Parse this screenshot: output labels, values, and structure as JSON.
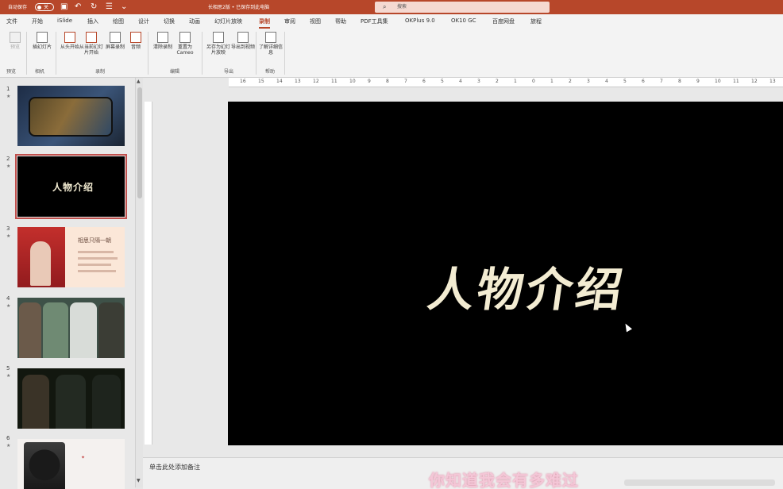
{
  "title_bar": {
    "autosave_label": "自动保存",
    "autosave_state": "关",
    "doc_title": "长相思2版 • 已保存到此电脑",
    "search_placeholder": "搜索"
  },
  "menu": {
    "tabs": [
      {
        "label": "文件"
      },
      {
        "label": "开始"
      },
      {
        "label": "iSlide"
      },
      {
        "label": "插入"
      },
      {
        "label": "绘图"
      },
      {
        "label": "设计"
      },
      {
        "label": "切换"
      },
      {
        "label": "动画"
      },
      {
        "label": "幻灯片放映"
      },
      {
        "label": "录制"
      },
      {
        "label": "审阅"
      },
      {
        "label": "视图"
      },
      {
        "label": "帮助"
      },
      {
        "label": "PDF工具集"
      },
      {
        "label": "OKPlus 9.0"
      },
      {
        "label": "OK10 GC"
      },
      {
        "label": "百度网盘"
      },
      {
        "label": "旅程"
      }
    ],
    "active": "录制"
  },
  "ribbon": {
    "buttons": [
      {
        "label": "预览"
      },
      {
        "label": "插幻灯片"
      },
      {
        "label": "从头开始"
      },
      {
        "label": "从当前幻灯片开始"
      },
      {
        "label": "屏幕录制"
      },
      {
        "label": "音频"
      },
      {
        "label": "清除录制"
      },
      {
        "label": "重置为Cameo"
      },
      {
        "label": "另存为幻灯片放映"
      },
      {
        "label": "导出到视频"
      },
      {
        "label": "了解详细信息"
      }
    ],
    "groups": [
      "预览",
      "相机",
      "录制",
      "编辑",
      "导出",
      "帮助"
    ]
  },
  "thumbnails": {
    "numbers": [
      "1",
      "2",
      "3",
      "4",
      "5",
      "6"
    ],
    "selected": 2,
    "slide2_text": "人物介绍",
    "slide3_caption": "相思只隔一朝"
  },
  "ruler": {
    "ticks": [
      "16",
      "15",
      "14",
      "13",
      "12",
      "11",
      "10",
      "9",
      "8",
      "7",
      "6",
      "5",
      "4",
      "3",
      "2",
      "1",
      "0",
      "1",
      "2",
      "3",
      "4",
      "5",
      "6",
      "7",
      "8",
      "9",
      "10",
      "11",
      "12",
      "13"
    ]
  },
  "slide": {
    "title": "人物介绍"
  },
  "notes": {
    "placeholder": "单击此处添加备注"
  },
  "overlay": {
    "subtitle": "你知道我会有多难过"
  },
  "colors": {
    "accent": "#b7472a",
    "slide_bg": "#000000",
    "title_text": "#f3ecd2",
    "subtitle": "#f4c7d7"
  }
}
